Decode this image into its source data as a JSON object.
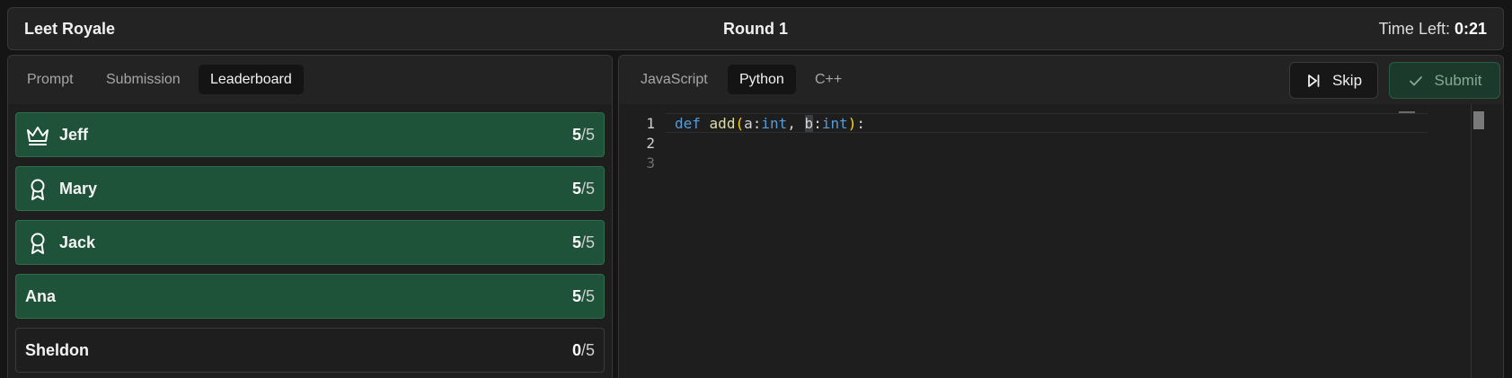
{
  "header": {
    "app_title": "Leet Royale",
    "round": "Round 1",
    "time_label": "Time Left: ",
    "time_value": "0:21"
  },
  "left_panel": {
    "tabs": [
      {
        "label": "Prompt",
        "active": false
      },
      {
        "label": "Submission",
        "active": false
      },
      {
        "label": "Leaderboard",
        "active": true
      }
    ],
    "leaderboard": [
      {
        "name": "Jeff",
        "icon": "crown-icon",
        "score": "5",
        "total": "/5",
        "status": "solved"
      },
      {
        "name": "Mary",
        "icon": "award-ribbon-icon",
        "score": "5",
        "total": "/5",
        "status": "solved"
      },
      {
        "name": "Jack",
        "icon": "award-ribbon-icon",
        "score": "5",
        "total": "/5",
        "status": "solved"
      },
      {
        "name": "Ana",
        "icon": "",
        "score": "5",
        "total": "/5",
        "status": "solved"
      },
      {
        "name": "Sheldon",
        "icon": "",
        "score": "0",
        "total": "/5",
        "status": "unsolved"
      }
    ]
  },
  "right_panel": {
    "language_tabs": [
      {
        "label": "JavaScript",
        "active": false
      },
      {
        "label": "Python",
        "active": true
      },
      {
        "label": "C++",
        "active": false
      }
    ],
    "skip_label": "Skip",
    "submit_label": "Submit",
    "editor": {
      "line_numbers": [
        "1",
        "2",
        "3"
      ],
      "code_tokens": {
        "def": "def",
        "fn": "add",
        "open": "(",
        "a": "a",
        "colon1": ":",
        "int1": "int",
        "comma": ", ",
        "b": "b",
        "colon2": ":",
        "int2": "int",
        "close": ")",
        "colon3": ":"
      }
    }
  },
  "colors": {
    "accent_green": "#1e533a",
    "row_border_green": "#2f6d4c",
    "background": "#151515",
    "panel": "#1e1e1e"
  }
}
